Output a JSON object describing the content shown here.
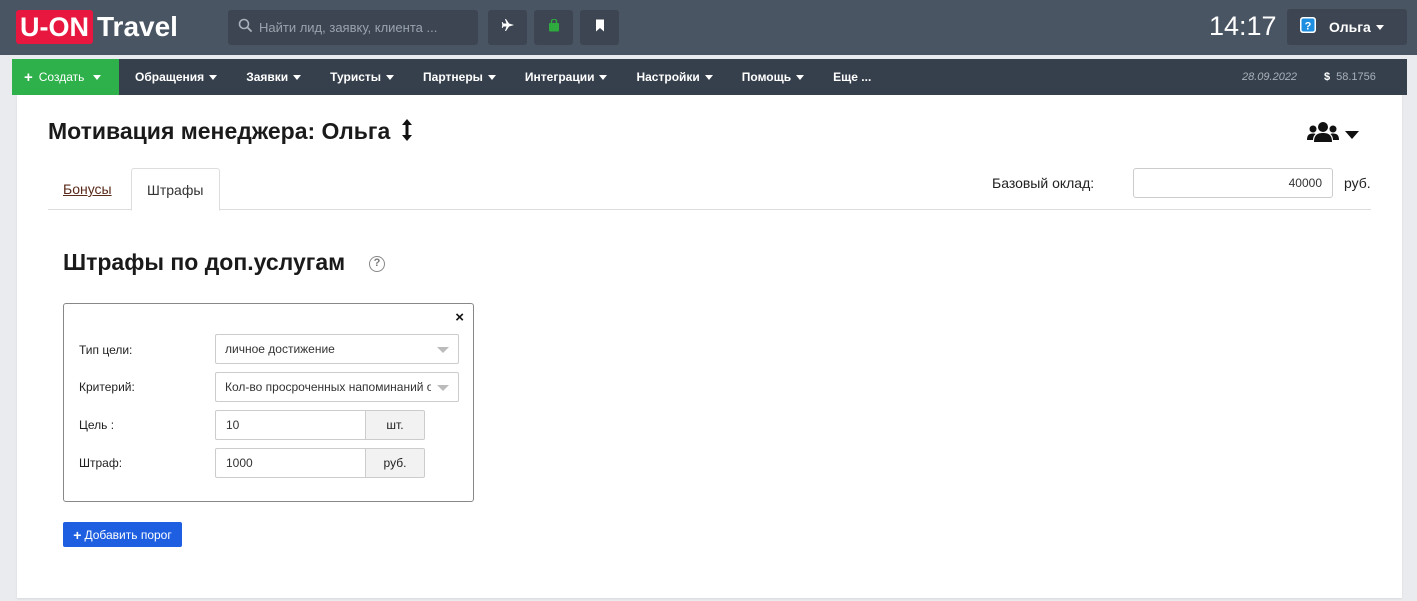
{
  "header": {
    "logo_left": "U-ON",
    "logo_right": "Travel",
    "search_placeholder": "Найти лид, заявку, клиента ...",
    "clock": "14:17",
    "user_name": "Ольга",
    "toolbar_icons": [
      "airplane-icon",
      "bag-icon",
      "bookmark-icon"
    ],
    "colors": {
      "topbar": "#4a5563",
      "navbar": "#36404c",
      "logo": "#e8173f",
      "create": "#2eb04b",
      "accent": "#1d5fe0"
    }
  },
  "nav": {
    "create_label": "Создать",
    "items": [
      {
        "label": "Обращения"
      },
      {
        "label": "Заявки"
      },
      {
        "label": "Туристы"
      },
      {
        "label": "Партнеры"
      },
      {
        "label": "Интеграции"
      },
      {
        "label": "Настройки"
      },
      {
        "label": "Помощь"
      },
      {
        "label": "Еще ..."
      }
    ],
    "date": "28.09.2022",
    "currency_symbol": "$",
    "rate": "58.1756"
  },
  "page": {
    "title": "Мотивация менеджера: Ольга",
    "tabs": [
      {
        "label": "Бонусы",
        "active": false
      },
      {
        "label": "Штрафы",
        "active": true
      }
    ],
    "salary_label": "Базовый оклад:",
    "salary_value": "40000",
    "salary_unit": "руб."
  },
  "section": {
    "title": "Штрафы по доп.услугам",
    "help_glyph": "?",
    "close_glyph": "×",
    "form": {
      "goal_type_label": "Тип цели:",
      "goal_type_value": "личное достижение",
      "criterion_label": "Критерий:",
      "criterion_value": "Кол-во просроченных напоминаний о",
      "target_label": "Цель :",
      "target_value": "10",
      "target_unit": "шт.",
      "fine_label": "Штраф:",
      "fine_value": "1000",
      "fine_unit": "руб."
    },
    "add_button": "Добавить порог"
  }
}
